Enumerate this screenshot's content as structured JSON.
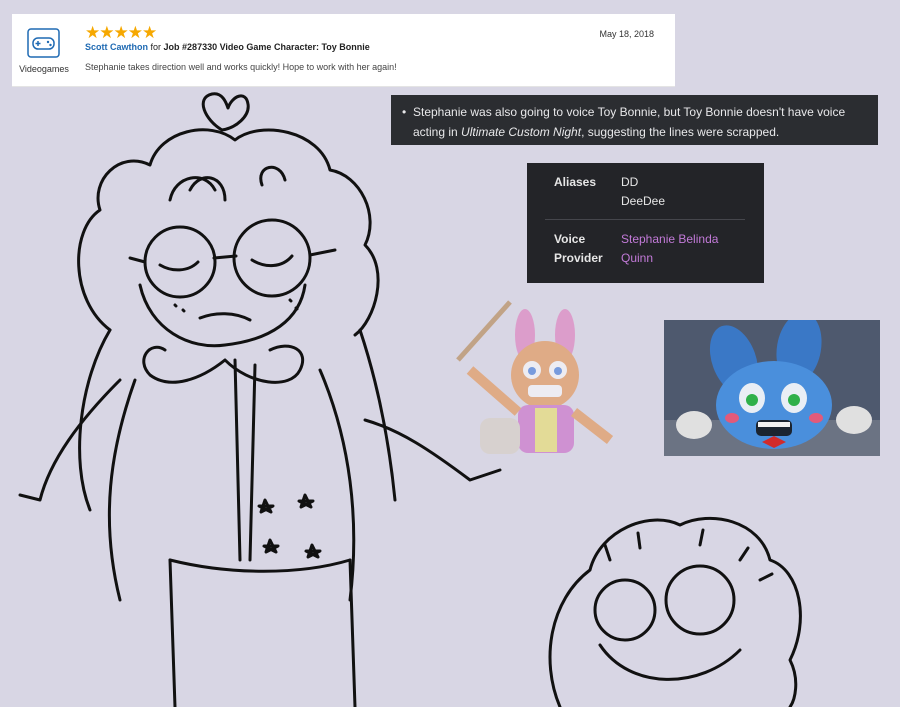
{
  "review": {
    "category_icon": "gamepad-icon",
    "category_label": "Videogames",
    "rating": 5,
    "stars_text": "★★★★★",
    "author": "Scott Cawthon",
    "for_text": "for",
    "job": "Job #287330 Video Game Character: Toy Bonnie",
    "date": "May 18, 2018",
    "body": "Stephanie takes direction well and works quickly! Hope to work with her again!"
  },
  "trivia": {
    "text_before": "Stephanie was also going to voice Toy Bonnie, but Toy Bonnie doesn't have voice acting in ",
    "title_italic": "Ultimate Custom Night",
    "text_after": ", suggesting the lines were scrapped."
  },
  "infobox": {
    "aliases_label": "Aliases",
    "aliases": [
      "DD",
      "DeeDee"
    ],
    "voice_label_1": "Voice",
    "voice_label_2": "Provider",
    "voice_provider_1": "Stephanie Belinda",
    "voice_provider_2": "Quinn",
    "link_color": "#c27ad8"
  },
  "colors": {
    "background": "#d8d6e4",
    "star": "#f6a800",
    "author_link": "#1f6ab3",
    "dark_panel": "#2b2d31"
  }
}
